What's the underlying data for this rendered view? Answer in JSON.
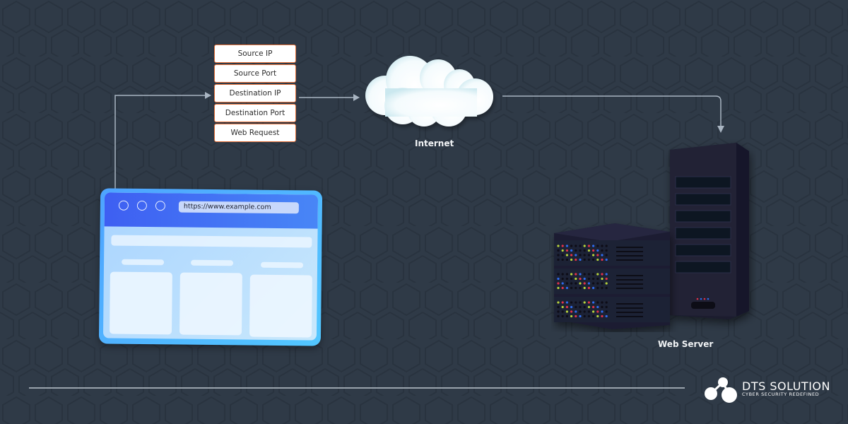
{
  "packet_fields": [
    "Source IP",
    "Source Port",
    "Destination IP",
    "Destination Port",
    "Web Request"
  ],
  "browser": {
    "url": "https://www.example.com",
    "window_controls": [
      "circle",
      "circle",
      "circle"
    ]
  },
  "nodes": {
    "internet_label": "Internet",
    "server_label": "Web Server"
  },
  "flow": [
    "browser",
    "packet",
    "internet",
    "web-server"
  ],
  "brand": {
    "name": "DTS SOLUTION",
    "tagline": "CYBER SECURITY REDEFINED"
  },
  "colors": {
    "background": "#2f3a47",
    "field_border": "#e8733b",
    "connector": "#a9b5c2",
    "browser_bar": "#3e5ff2"
  }
}
